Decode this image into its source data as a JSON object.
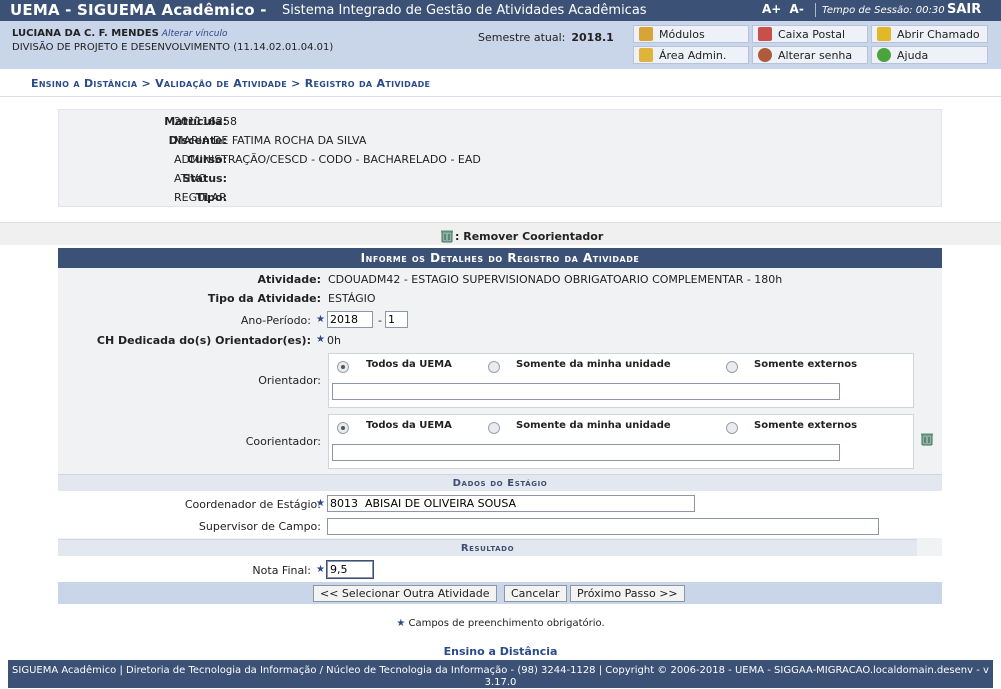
{
  "topbar": {
    "brand": "UEMA - SIGUEMA Acadêmico -",
    "subtitle": "Sistema Integrado de Gestão de Atividades Acadêmicas",
    "font_up": "A+",
    "font_down": "A-",
    "session_label": "Tempo de Sessão: 00:30",
    "logout": "SAIR"
  },
  "header": {
    "user_name": "LUCIANA DA C. F. MENDES",
    "change_link": "Alterar vínculo",
    "division": "DIVISÃO DE PROJETO E DESENVOLVIMENTO (11.14.02.01.04.01)",
    "semester_label": "Semestre atual:",
    "semester_value": "2018.1",
    "buttons": {
      "modulos": "Módulos",
      "caixa_postal": "Caixa Postal",
      "abrir_chamado": "Abrir Chamado",
      "area_admin": "Área Admin.",
      "alterar_senha": "Alterar senha",
      "ajuda": "Ajuda"
    }
  },
  "breadcrumb": "Ensino a Distância > Validação de Atividade > Registro da Atividade",
  "student": {
    "matricula_label": "Matrícula:",
    "matricula": "201116258",
    "discente_label": "Discente:",
    "discente": "MARIA DE FATIMA ROCHA DA SILVA",
    "curso_label": "Curso:",
    "curso": "ADMINISTRAÇÃO/CESCD - CODO - BACHARELADO - EAD",
    "status_label": "Status:",
    "status": "ATIVO",
    "tipo_label": "Tipo:",
    "tipo": "REGULAR"
  },
  "remove_coorientador": ": Remover Coorientador",
  "form": {
    "caption": "Informe os Detalhes do Registro da Atividade",
    "atividade_label": "Atividade:",
    "atividade": "CDOUADM42 - ESTAGIO SUPERVISIONADO OBRIGATOARIO COMPLEMENTAR - 180h",
    "tipo_atividade_label": "Tipo da Atividade:",
    "tipo_atividade": "ESTÁGIO",
    "ano_periodo_label": "Ano-Período:",
    "ano": "2018",
    "periodo": "1",
    "dash": "-",
    "ch_label": "CH Dedicada do(s) Orientador(es):",
    "ch_value": "0h",
    "orientador_label": "Orientador:",
    "coorientador_label": "Coorientador:",
    "radio_options": [
      "Todos da UEMA",
      "Somente da minha unidade",
      "Somente externos"
    ],
    "dados_estagio_caption": "Dados do Estágio",
    "coordenador_label": "Coordenador de Estágio:",
    "coordenador_value": "8013  ABISAI DE OLIVEIRA SOUSA",
    "supervisor_label": "Supervisor de Campo:",
    "supervisor_value": "",
    "resultado_caption": "Resultado",
    "nota_label": "Nota Final:",
    "nota_value": "9,5",
    "btn_selecionar": "<< Selecionar Outra Atividade",
    "btn_cancelar": "Cancelar",
    "btn_proximo": "Próximo Passo >>"
  },
  "required_note": "Campos de preenchimento obrigatório.",
  "required_star": "★",
  "back_link": "Ensino a Distância",
  "footer": "SIGUEMA Acadêmico | Diretoria de Tecnologia da Informação / Núcleo de Tecnologia da Informação - (98) 3244-1128 | Copyright © 2006-2018 - UEMA - SIGGAA-MIGRACAO.localdomain.desenv - v 3.17.0"
}
